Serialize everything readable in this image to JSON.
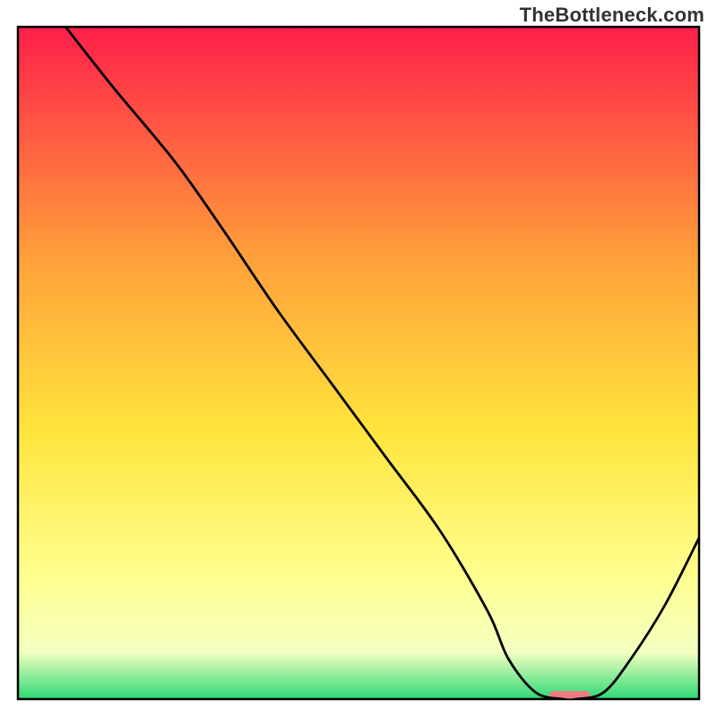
{
  "watermark": "TheBottleneck.com",
  "chart_data": {
    "type": "line",
    "title": "",
    "xlabel": "",
    "ylabel": "",
    "xlim": [
      0,
      100
    ],
    "ylim": [
      0,
      100
    ],
    "grid": false,
    "background_gradient": {
      "top": "#ff1f4a",
      "upper_mid": "#ffa23a",
      "mid": "#ffe43c",
      "lower_mid": "#ffff90",
      "lower": "#f4ffc1",
      "bottom": "#2dd975"
    },
    "series": [
      {
        "name": "bottleneck-curve",
        "color": "#000000",
        "x": [
          7,
          14,
          23,
          30,
          38,
          46,
          54,
          62,
          69,
          72,
          76,
          80,
          82,
          86,
          90,
          95,
          100
        ],
        "y": [
          100,
          91,
          80,
          70,
          58,
          47,
          36,
          25,
          13,
          6,
          1,
          0,
          0,
          1,
          6,
          14,
          24
        ]
      }
    ],
    "optimal_marker": {
      "name": "optimal-range",
      "color": "#ef7a82",
      "x_center": 81,
      "y": 0.6,
      "width": 6,
      "height": 1.2
    }
  }
}
